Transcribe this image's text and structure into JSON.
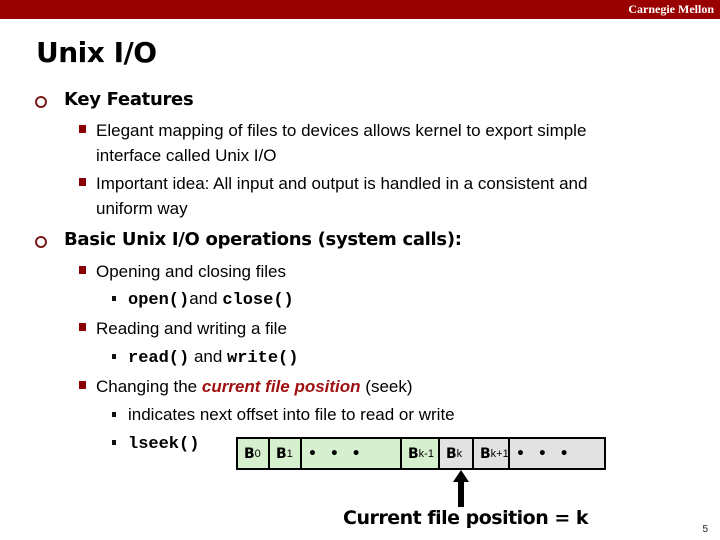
{
  "header": {
    "brand": "Carnegie Mellon"
  },
  "slide": {
    "title": "Unix I/O",
    "sections": [
      {
        "heading": "Key Features",
        "items": [
          {
            "line1": "Elegant mapping of files to devices allows kernel to export simple",
            "line2": "interface called Unix I/O"
          },
          {
            "line1": "Important idea: All input and output is handled in a consistent and",
            "line2": "uniform way"
          }
        ]
      },
      {
        "heading": "Basic Unix I/O operations (system calls):",
        "items": [
          {
            "text": "Opening and closing files",
            "sub": {
              "code1": "open()",
              "mid": "and ",
              "code2": "close()"
            }
          },
          {
            "text": "Reading and writing a file",
            "sub": {
              "code1": "read()",
              "mid": " and ",
              "code2": "write()"
            }
          },
          {
            "text_before": "Changing the ",
            "emphasis": "current file position",
            "text_after": " (seek)",
            "subs": {
              "offset": "indicates next offset into file to read or write",
              "code": "lseek()"
            }
          }
        ]
      }
    ],
    "diagram": {
      "cells": [
        {
          "label": "B",
          "sub": "0",
          "state": "read"
        },
        {
          "label": "B",
          "sub": "1",
          "state": "read"
        },
        {
          "label": "• • •",
          "sub": "",
          "state": "read"
        },
        {
          "label": "B",
          "sub": "k-1",
          "state": "read"
        },
        {
          "label": "B",
          "sub": "k",
          "state": "unread"
        },
        {
          "label": "B",
          "sub": "k+1",
          "state": "unread"
        },
        {
          "label": "• • •",
          "sub": "",
          "state": "unread"
        }
      ],
      "pointer_label": "Current file position = k",
      "colors": {
        "read": "#d6f0cf",
        "unread": "#e2e2e2"
      }
    },
    "page_number": "5"
  },
  "colors": {
    "accent": "#990000"
  }
}
